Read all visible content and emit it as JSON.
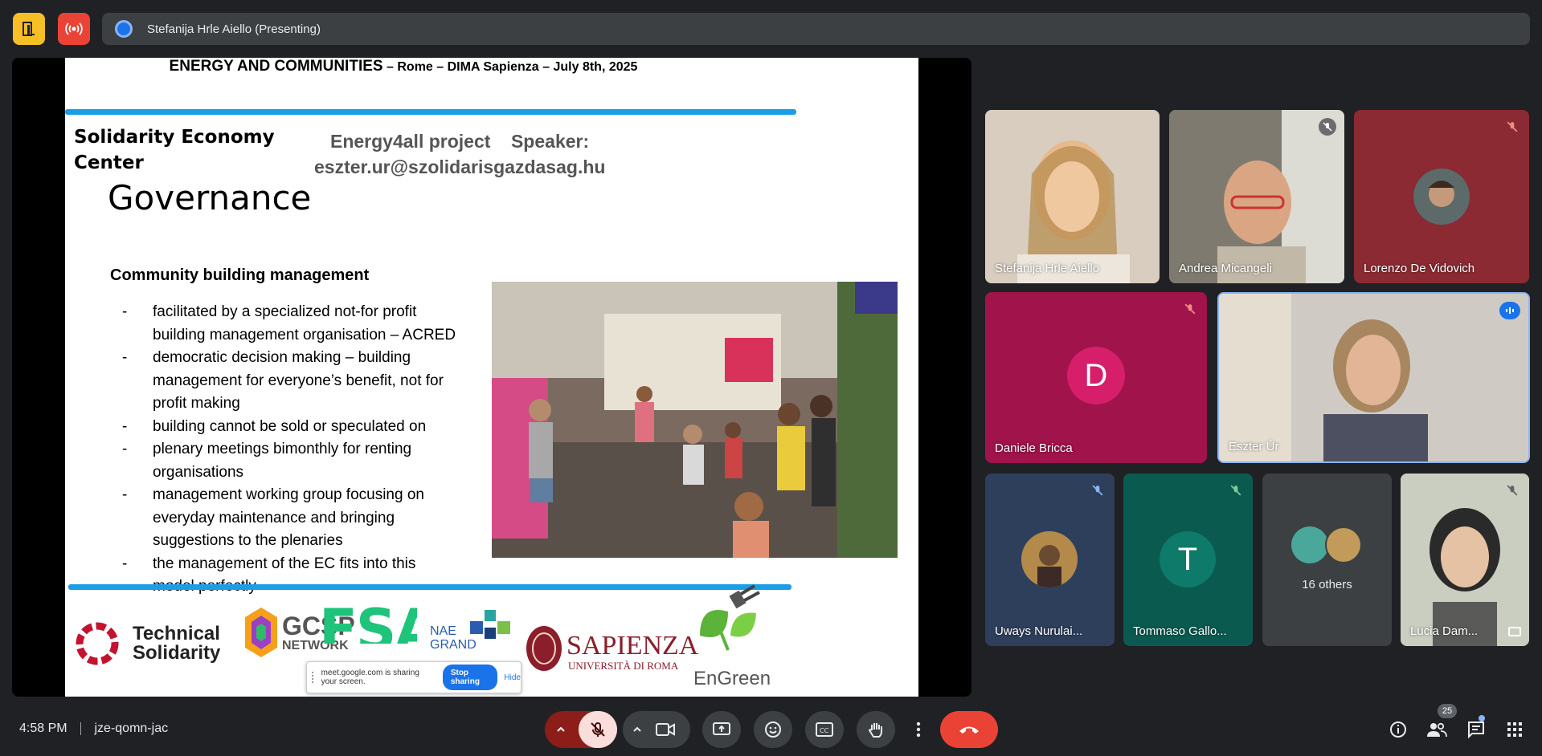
{
  "topbar": {
    "presenting_label": "Stefanija Hrle Aiello (Presenting)",
    "colors": {
      "yellow_btn": "#f6bf26",
      "red_btn": "#ea4335"
    }
  },
  "slide": {
    "header_big": "ENERGY AND COMMUNITIES",
    "header_small": " – Rome – DIMA Sapienza – July 8th, 2025",
    "org_line1": "Solidarity Economy",
    "org_line2": "Center",
    "project_line1": "Energy4all project    Speaker:",
    "project_line2": "eszter.ur@szolidarisgazdasag.hu",
    "title": "Governance",
    "subtitle": "Community building management",
    "bullets": [
      {
        "dash": "-",
        "lines": [
          "facilitated by a specialized not-for profit",
          "building management organisation – ACRED"
        ]
      },
      {
        "dash": "-",
        "lines": [
          "democratic decision making – building",
          "management for everyone’s benefit, not for",
          "profit making"
        ]
      },
      {
        "dash": "-",
        "lines": [
          "building cannot be sold or speculated on"
        ]
      },
      {
        "dash": "-",
        "lines": [
          "plenary meetings bimonthly for renting",
          "organisations"
        ]
      },
      {
        "dash": "-",
        "lines": [
          "management working group focusing on",
          "everyday maintenance and bringing",
          "suggestions to the plenaries"
        ]
      },
      {
        "dash": "-",
        "lines": [
          "the management of the EC fits into this",
          "model perfectly"
        ]
      }
    ],
    "logos": {
      "ts_line1": "Technical",
      "ts_line2": "Solidarity",
      "gcsp": "GCSP",
      "gcsp_sub": "NETWORK",
      "fsa": "FSA",
      "nae1": "NAE",
      "nae2": "GRAND",
      "sapienza": "SAPIENZA",
      "sapienza_sub": "UNIVERSITÀ DI ROMA",
      "engreen": "EnGreen"
    }
  },
  "share_popup": {
    "message": "meet.google.com is sharing your screen.",
    "stop_label": "Stop sharing",
    "hide_label": "Hide"
  },
  "participants": [
    {
      "name": "Stefanija Hrle Aiello",
      "bg": "#c9b8a3"
    },
    {
      "name": "Andrea Micangeli",
      "bg": "#8f8a7f"
    },
    {
      "name": "Lorenzo De Vidovich",
      "bg": "#8b2a33"
    },
    {
      "name": "Daniele Bricca",
      "bg": "#a0134b",
      "initial": "D"
    },
    {
      "name": "Eszter Úr",
      "bg": "#c5c2bc"
    },
    {
      "name": "Uways Nurulai...",
      "bg": "#2e3f5c"
    },
    {
      "name": "Tommaso Gallo...",
      "bg": "#0b5a50",
      "initial": "T"
    },
    {
      "name": "16 others",
      "bg": "#3c4043"
    },
    {
      "name": "Lucia Dam...",
      "bg": "#b9bfae"
    }
  ],
  "bottombar": {
    "time": "4:58 PM",
    "meeting_code": "jze-qomn-jac",
    "people_count": "25",
    "colors": {
      "mic_muted": "#f9dedc",
      "end_call": "#ea4335",
      "mic_caret": "#8c1d18"
    }
  }
}
